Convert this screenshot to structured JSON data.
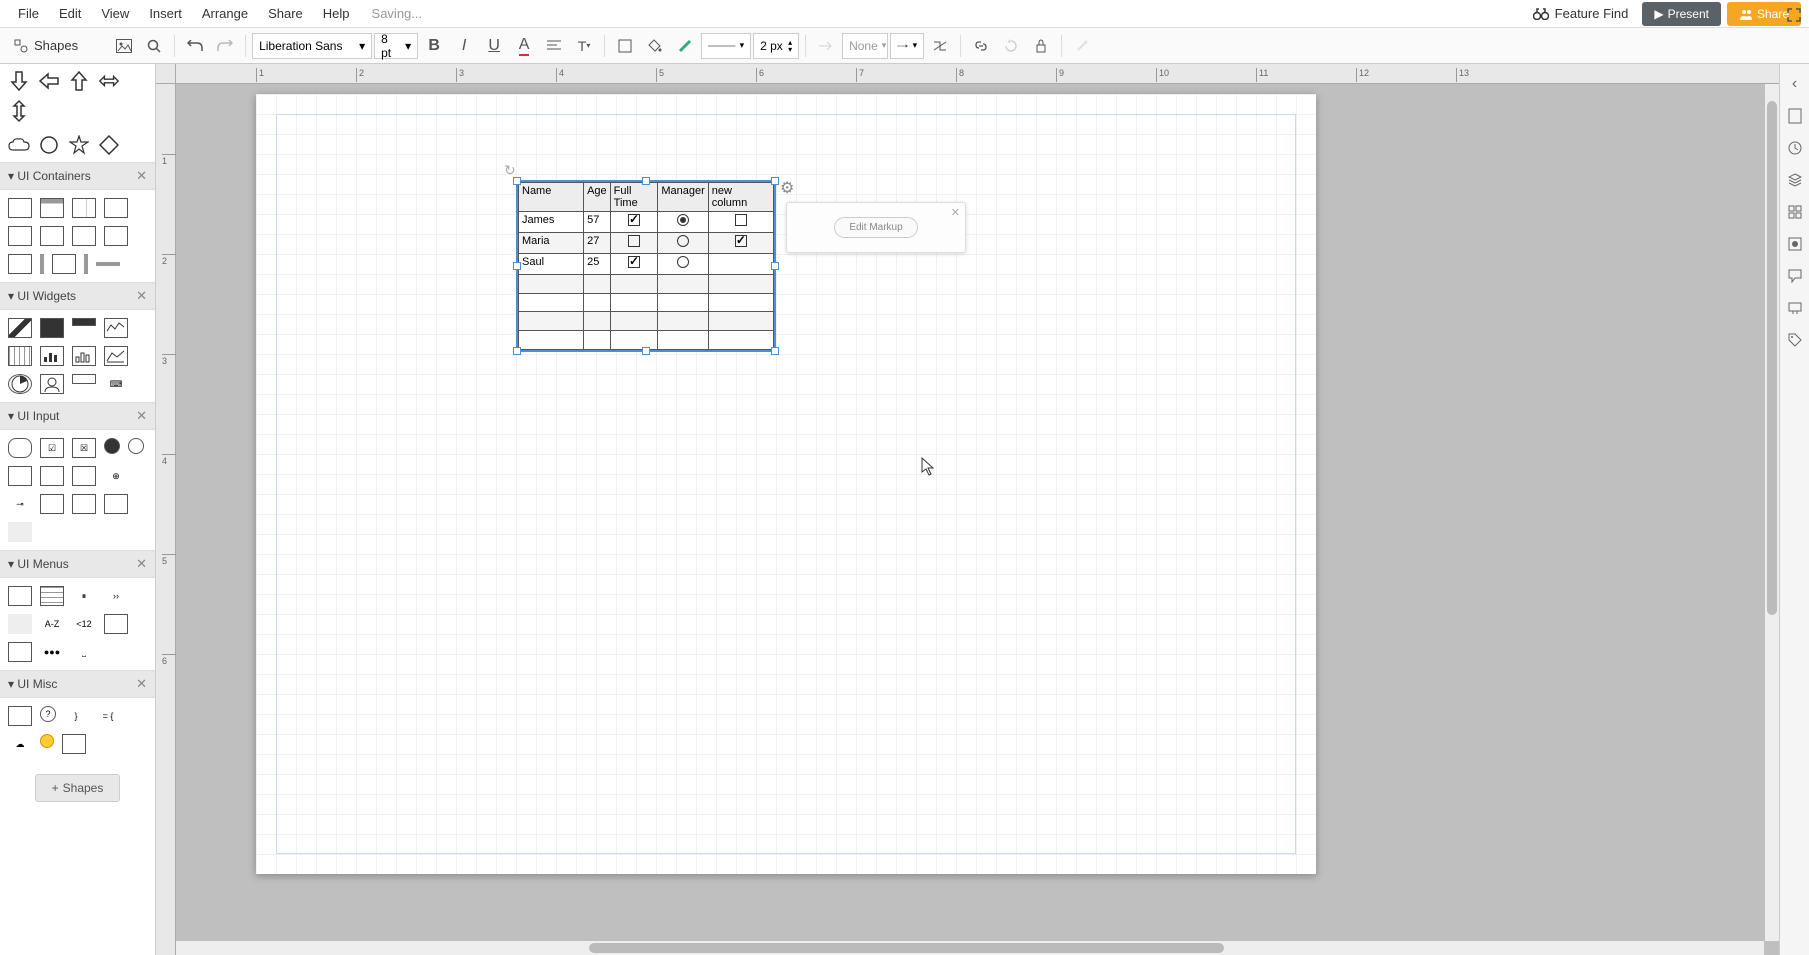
{
  "menu": {
    "items": [
      "File",
      "Edit",
      "View",
      "Insert",
      "Arrange",
      "Share",
      "Help"
    ],
    "saving": "Saving...",
    "feature_find": "Feature Find",
    "present": "Present",
    "share": "Share"
  },
  "toolbar": {
    "shapes_label": "Shapes",
    "font": "Liberation Sans",
    "font_size": "8 pt",
    "line_width": "2 px",
    "arrow_start": "None"
  },
  "sections": {
    "ui_containers": "UI Containers",
    "ui_widgets": "UI Widgets",
    "ui_input": "UI Input",
    "ui_menus": "UI Menus",
    "ui_misc": "UI Misc"
  },
  "shapes_btn": "Shapes",
  "ruler_h": [
    "1",
    "2",
    "3",
    "4",
    "5",
    "6",
    "7",
    "8",
    "9",
    "10",
    "11",
    "12",
    "13"
  ],
  "ruler_v": [
    "1",
    "2",
    "3",
    "4",
    "5",
    "6"
  ],
  "table": {
    "headers": [
      "Name",
      "Age",
      "Full Time",
      "Manager",
      "new column"
    ],
    "rows": [
      {
        "name": "James",
        "age": "57",
        "fulltime": true,
        "manager": "checked",
        "newcol": false
      },
      {
        "name": "Maria",
        "age": "27",
        "fulltime": false,
        "manager": "unchecked",
        "newcol": true
      },
      {
        "name": "Saul",
        "age": "25",
        "fulltime": true,
        "manager": "unchecked",
        "newcol": null
      }
    ]
  },
  "popup": {
    "edit_markup": "Edit Markup"
  },
  "shape_items": {
    "az": "A-Z",
    "less12": "<12",
    "ooo": "●●●"
  }
}
